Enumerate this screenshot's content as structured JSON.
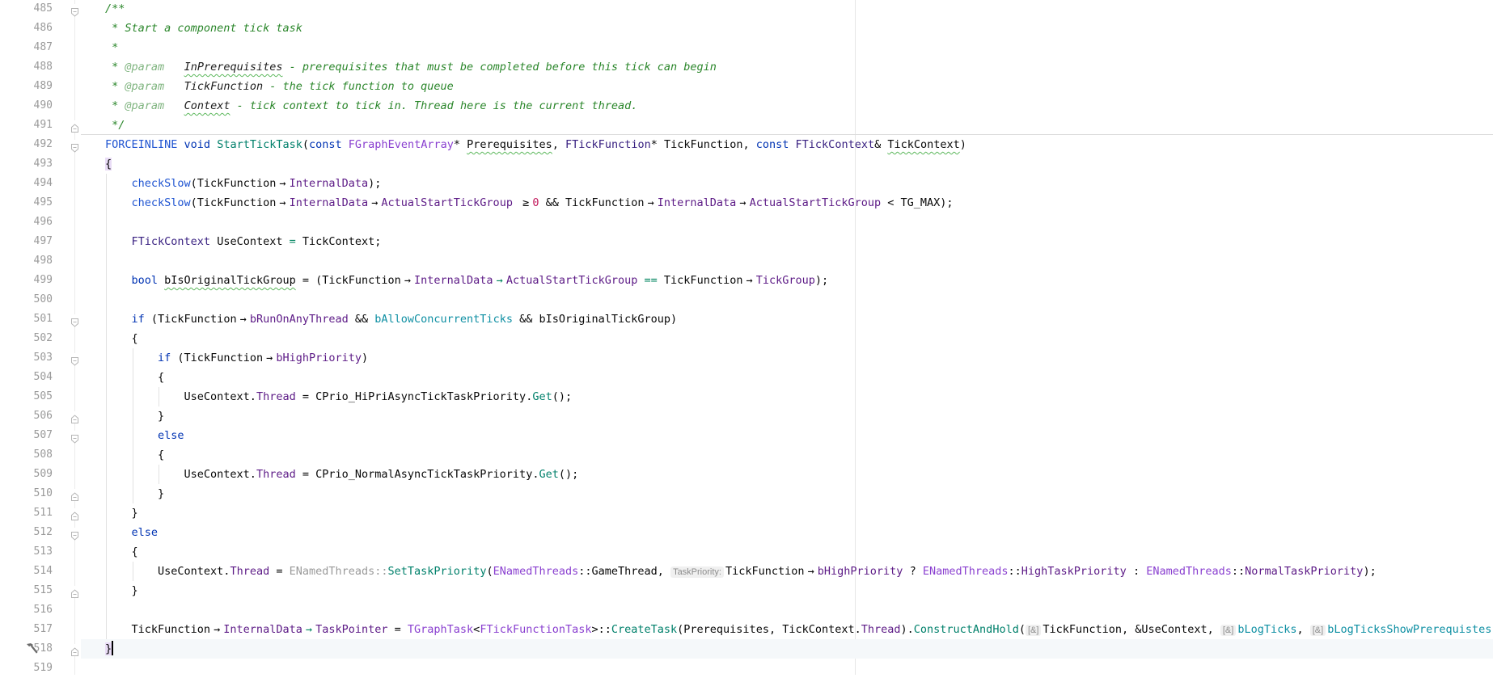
{
  "editor": {
    "current_line": "518",
    "lines": [
      {
        "n": "485",
        "fold": "start",
        "tokens": [
          [
            "c",
            "/**"
          ]
        ]
      },
      {
        "n": "486",
        "tokens": [
          [
            "c",
            " * Start a component tick task"
          ]
        ]
      },
      {
        "n": "487",
        "tokens": [
          [
            "c",
            " *"
          ]
        ]
      },
      {
        "n": "488",
        "tokens": [
          [
            "c",
            " * "
          ],
          [
            "ct",
            "@param"
          ],
          [
            "c",
            "   "
          ],
          [
            "cp w",
            "InPrerequisites"
          ],
          [
            "c",
            " - prerequisites that must be completed before this tick can begin"
          ]
        ]
      },
      {
        "n": "489",
        "tokens": [
          [
            "c",
            " * "
          ],
          [
            "ct",
            "@param"
          ],
          [
            "c",
            "   "
          ],
          [
            "cp",
            "TickFunction"
          ],
          [
            "c",
            " - the tick function to queue"
          ]
        ]
      },
      {
        "n": "490",
        "tokens": [
          [
            "c",
            " * "
          ],
          [
            "ct",
            "@param"
          ],
          [
            "c",
            "   "
          ],
          [
            "cp w",
            "Context"
          ],
          [
            "c",
            " - tick context to tick in. Thread here is the current thread."
          ]
        ]
      },
      {
        "n": "491",
        "fold": "end",
        "tokens": [
          [
            "c",
            " */"
          ]
        ]
      },
      {
        "n": "492",
        "fold": "start",
        "separator": true,
        "tokens": [
          [
            "mac",
            "FORCEINLINE"
          ],
          [
            "t",
            " "
          ],
          [
            "k",
            "void"
          ],
          [
            "t",
            " "
          ],
          [
            "fn",
            "StartTickTask"
          ],
          [
            "t",
            "("
          ],
          [
            "k",
            "const"
          ],
          [
            "t",
            " "
          ],
          [
            "ty",
            "FGraphEventArray"
          ],
          [
            "t",
            "* "
          ],
          [
            "t w",
            "Prerequisites"
          ],
          [
            "t",
            ", "
          ],
          [
            "ty2",
            "FTickFunction"
          ],
          [
            "t",
            "* TickFunction, "
          ],
          [
            "k",
            "const"
          ],
          [
            "t",
            " "
          ],
          [
            "ty2",
            "FTickContext"
          ],
          [
            "t",
            "& "
          ],
          [
            "t w",
            "TickContext"
          ],
          [
            "t",
            ")"
          ]
        ]
      },
      {
        "n": "493",
        "tokens": [
          [
            "t bh",
            "{"
          ]
        ]
      },
      {
        "n": "494",
        "tokens": [
          [
            "t",
            "    "
          ],
          [
            "mac",
            "checkSlow"
          ],
          [
            "t",
            "(TickFunction→"
          ],
          [
            "mem",
            "InternalData"
          ],
          [
            "t",
            ");"
          ]
        ]
      },
      {
        "n": "495",
        "tokens": [
          [
            "t",
            "    "
          ],
          [
            "mac",
            "checkSlow"
          ],
          [
            "t",
            "(TickFunction→"
          ],
          [
            "mem",
            "InternalData"
          ],
          [
            "t",
            "→"
          ],
          [
            "mem",
            "ActualStartTickGroup"
          ],
          [
            "t",
            " ≥"
          ],
          [
            "num",
            "0"
          ],
          [
            "t",
            " && TickFunction→"
          ],
          [
            "mem",
            "InternalData"
          ],
          [
            "t",
            "→"
          ],
          [
            "mem",
            "ActualStartTickGroup"
          ],
          [
            "t",
            " < TG_MAX);"
          ]
        ]
      },
      {
        "n": "496",
        "tokens": []
      },
      {
        "n": "497",
        "tokens": [
          [
            "t",
            "    "
          ],
          [
            "ty2",
            "FTickContext"
          ],
          [
            "t",
            " UseContext "
          ],
          [
            "op",
            "="
          ],
          [
            "t",
            " TickContext;"
          ]
        ]
      },
      {
        "n": "498",
        "tokens": []
      },
      {
        "n": "499",
        "tokens": [
          [
            "t",
            "    "
          ],
          [
            "k",
            "bool"
          ],
          [
            "t",
            " "
          ],
          [
            "t w",
            "bIsOriginalTickGroup"
          ],
          [
            "t",
            " = (TickFunction→"
          ],
          [
            "mem",
            "InternalData"
          ],
          [
            "op",
            "→"
          ],
          [
            "mem",
            "ActualStartTickGroup"
          ],
          [
            "t",
            " "
          ],
          [
            "op",
            "=="
          ],
          [
            "t",
            " TickFunction→"
          ],
          [
            "mem",
            "TickGroup"
          ],
          [
            "t",
            ");"
          ]
        ]
      },
      {
        "n": "500",
        "tokens": []
      },
      {
        "n": "501",
        "fold": "start",
        "tokens": [
          [
            "t",
            "    "
          ],
          [
            "k",
            "if"
          ],
          [
            "t",
            " (TickFunction→"
          ],
          [
            "mem",
            "bRunOnAnyThread"
          ],
          [
            "t",
            " && "
          ],
          [
            "gl",
            "bAllowConcurrentTicks"
          ],
          [
            "t",
            " && bIsOriginalTickGroup)"
          ]
        ]
      },
      {
        "n": "502",
        "tokens": [
          [
            "t",
            "    {"
          ]
        ]
      },
      {
        "n": "503",
        "fold": "start",
        "tokens": [
          [
            "t",
            "        "
          ],
          [
            "k",
            "if"
          ],
          [
            "t",
            " (TickFunction→"
          ],
          [
            "mem",
            "bHighPriority"
          ],
          [
            "t",
            ")"
          ]
        ]
      },
      {
        "n": "504",
        "tokens": [
          [
            "t",
            "        {"
          ]
        ]
      },
      {
        "n": "505",
        "tokens": [
          [
            "t",
            "            UseContext."
          ],
          [
            "mem",
            "Thread"
          ],
          [
            "t",
            " = CPrio_HiPriAsyncTickTaskPriority."
          ],
          [
            "fn",
            "Get"
          ],
          [
            "t",
            "();"
          ]
        ]
      },
      {
        "n": "506",
        "fold": "end",
        "tokens": [
          [
            "t",
            "        }"
          ]
        ]
      },
      {
        "n": "507",
        "fold": "start",
        "tokens": [
          [
            "t",
            "        "
          ],
          [
            "k",
            "else"
          ]
        ]
      },
      {
        "n": "508",
        "tokens": [
          [
            "t",
            "        {"
          ]
        ]
      },
      {
        "n": "509",
        "tokens": [
          [
            "t",
            "            UseContext."
          ],
          [
            "mem",
            "Thread"
          ],
          [
            "t",
            " = CPrio_NormalAsyncTickTaskPriority."
          ],
          [
            "fn",
            "Get"
          ],
          [
            "t",
            "();"
          ]
        ]
      },
      {
        "n": "510",
        "fold": "end",
        "tokens": [
          [
            "t",
            "        }"
          ]
        ]
      },
      {
        "n": "511",
        "fold": "end",
        "tokens": [
          [
            "t",
            "    }"
          ]
        ]
      },
      {
        "n": "512",
        "fold": "start",
        "tokens": [
          [
            "t",
            "    "
          ],
          [
            "k",
            "else"
          ]
        ]
      },
      {
        "n": "513",
        "tokens": [
          [
            "t",
            "    {"
          ]
        ]
      },
      {
        "n": "514",
        "tokens": [
          [
            "t",
            "        UseContext."
          ],
          [
            "mem",
            "Thread"
          ],
          [
            "t",
            " = "
          ],
          [
            "dim",
            "ENamedThreads::"
          ],
          [
            "fn",
            "SetTaskPriority"
          ],
          [
            "t",
            "("
          ],
          [
            "ty",
            "ENamedThreads"
          ],
          [
            "t",
            "::GameThread, "
          ],
          [
            "h",
            "TaskPriority:"
          ],
          [
            "t",
            "TickFunction→"
          ],
          [
            "mem",
            "bHighPriority"
          ],
          [
            "t",
            " ? "
          ],
          [
            "ty",
            "ENamedThreads"
          ],
          [
            "t",
            "::"
          ],
          [
            "mem",
            "HighTaskPriority"
          ],
          [
            "t",
            " : "
          ],
          [
            "ty",
            "ENamedThreads"
          ],
          [
            "t",
            "::"
          ],
          [
            "mem",
            "NormalTaskPriority"
          ],
          [
            "t",
            ");"
          ]
        ]
      },
      {
        "n": "515",
        "fold": "end",
        "tokens": [
          [
            "t",
            "    }"
          ]
        ]
      },
      {
        "n": "516",
        "tokens": []
      },
      {
        "n": "517",
        "tokens": [
          [
            "t",
            "    TickFunction→"
          ],
          [
            "mem",
            "InternalData"
          ],
          [
            "op",
            "→"
          ],
          [
            "mem",
            "TaskPointer"
          ],
          [
            "t",
            " = "
          ],
          [
            "ty",
            "TGraphTask"
          ],
          [
            "t",
            "<"
          ],
          [
            "ty",
            "FTickFunctionTask"
          ],
          [
            "t",
            ">::"
          ],
          [
            "fn",
            "CreateTask"
          ],
          [
            "t",
            "(Prerequisites, TickContext."
          ],
          [
            "mem",
            "Thread"
          ],
          [
            "t",
            ")."
          ],
          [
            "fn",
            "ConstructAndHold"
          ],
          [
            "t",
            "("
          ],
          [
            "h",
            "[&]"
          ],
          [
            "t",
            "TickFunction, &UseContext, "
          ],
          [
            "h",
            "[&]"
          ],
          [
            "gl",
            "bLogTicks"
          ],
          [
            "t",
            ", "
          ],
          [
            "h",
            "[&]"
          ],
          [
            "gl",
            "bLogTicksShowPrerequistes"
          ],
          [
            "t",
            ");"
          ]
        ]
      },
      {
        "n": "518",
        "fold": "end",
        "current": true,
        "gutter_icon": "hammer-icon",
        "caret": true,
        "tokens": [
          [
            "t bh",
            "}"
          ]
        ]
      },
      {
        "n": "519",
        "tokens": []
      }
    ]
  },
  "colors": {
    "comment": "#2a862a",
    "keyword": "#0033b3",
    "function": "#00806b",
    "type": "#8a40d0",
    "member": "#5c1a86",
    "global": "#0e8fa3",
    "current_line_bg": "#f5f8fa",
    "brace_match": "#e9dcf6"
  }
}
